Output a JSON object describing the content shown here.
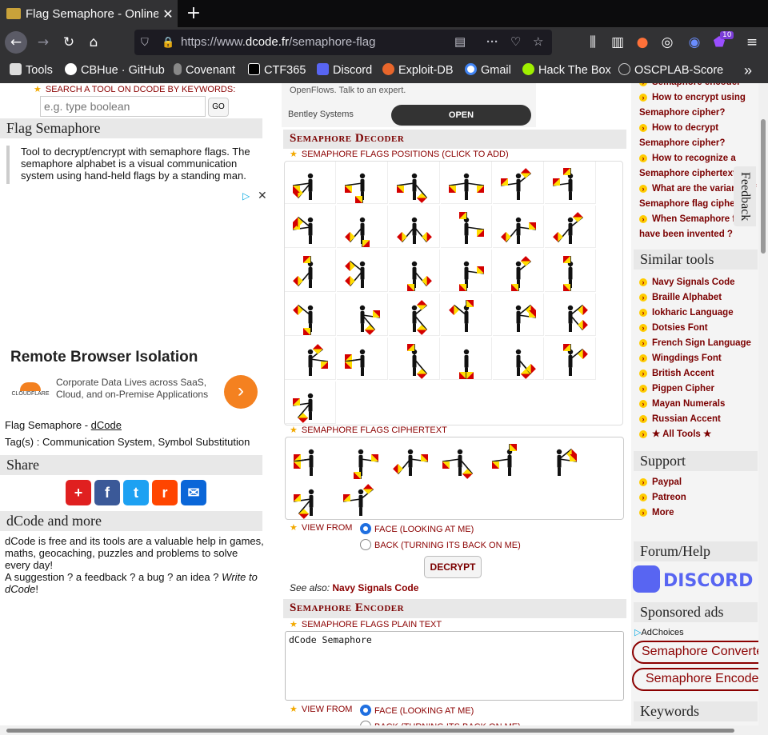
{
  "browser": {
    "tab_title": "Flag Semaphore - Online",
    "new_tab": "+",
    "url_prefix": "https://www.",
    "url_domain": "dcode.fr",
    "url_path": "/semaphore-flag",
    "extension_badge": "10",
    "bookmarks": [
      "Tools",
      "CBHue · GitHub",
      "Covenant",
      "CTF365",
      "Discord",
      "Exploit-DB",
      "Gmail",
      "Hack The Box",
      "OSCPLAB-Score"
    ]
  },
  "left": {
    "search_label": "SEARCH A TOOL ON DCODE BY KEYWORDS:",
    "search_placeholder": "e.g. type boolean",
    "go": "GO",
    "title": "Flag Semaphore",
    "description": "Tool to decrypt/encrypt with semaphore flags. The semaphore alphabet is a visual communication system using hand-held flags by a standing man.",
    "ad_title": "Remote Browser Isolation",
    "ad_text": "Corporate Data Lives across SaaS, Cloud, and on-Premise Applications",
    "ad_brand": "CLOUDFLARE",
    "credit_prefix": "Flag Semaphore - ",
    "credit_link": "dCode",
    "tags": "Tag(s) : Communication System, Symbol Substitution",
    "share_title": "Share",
    "more_title": "dCode and more",
    "more_text1": "dCode is free and its tools are a valuable help in games, maths, geocaching, puzzles and problems to solve every day!",
    "more_text2": "A suggestion ? a feedback ? a bug ? an idea ?",
    "more_link": "Write to dCode"
  },
  "mid": {
    "ad_top_text": "OpenFlows. Talk to an expert.",
    "ad_company": "Bentley Systems",
    "ad_open": "OPEN",
    "decoder_title": "Semaphore Decoder",
    "positions_label": "SEMAPHORE FLAGS POSITIONS (CLICK TO ADD)",
    "ciphertext_label": "SEMAPHORE FLAGS CIPHERTEXT",
    "view_from": "VIEW FROM",
    "face": "FACE (LOOKING AT ME)",
    "back": "BACK (TURNING ITS BACK ON ME)",
    "decrypt": "DECRYPT",
    "see_also_prefix": "See also: ",
    "see_also_link": "Navy Signals Code",
    "encoder_title": "Semaphore Encoder",
    "plaintext_label": "SEMAPHORE FLAGS PLAIN TEXT",
    "plaintext_value": "dCode Semaphore",
    "view_from2": "VIEW FROM",
    "face2": "FACE (LOOKING AT ME)",
    "back2": "BACK (TURNING ITS BACK ON ME)"
  },
  "right": {
    "faq": [
      "Semaphore encoder",
      "How to encrypt using Semaphore cipher?",
      "How to decrypt Semaphore cipher?",
      "How to recognize a Semaphore ciphertext?",
      "What are the variants of Semaphore flag cipher?",
      "When Semaphore flags have been invented ?"
    ],
    "feedback": "Feedback",
    "similar_title": "Similar tools",
    "similar": [
      "Navy Signals Code",
      "Braille Alphabet",
      "Iokharic Language",
      "Dotsies Font",
      "French Sign Language",
      "Wingdings Font",
      "British Accent",
      "Pigpen Cipher",
      "Mayan Numerals",
      "Russian Accent",
      "★ All Tools ★"
    ],
    "support_title": "Support",
    "support": [
      "Paypal",
      "Patreon",
      "More"
    ],
    "forum_title": "Forum/Help",
    "discord": "DISCORD",
    "sponsored_title": "Sponsored ads",
    "adchoices": "AdChoices",
    "sponsored_buttons": [
      "Semaphore Converter",
      "Semaphore Encoder"
    ],
    "keywords_title": "Keywords"
  },
  "colors": {
    "flag_red": "#d40000",
    "flag_yellow": "#ffdd00",
    "dcode_red": "#8b0000",
    "accent_blue": "#1f6fe0"
  },
  "semaphore": {
    "positions": [
      [
        5,
        6
      ],
      [
        4,
        6
      ],
      [
        3,
        6
      ],
      [
        2,
        6
      ],
      [
        6,
        1
      ],
      [
        6,
        0
      ],
      [
        6,
        7
      ],
      [
        5,
        4
      ],
      [
        5,
        3
      ],
      [
        2,
        0
      ],
      [
        5,
        2
      ],
      [
        5,
        1
      ],
      [
        5,
        0
      ],
      [
        5,
        7
      ],
      [
        4,
        3
      ],
      [
        4,
        2
      ],
      [
        4,
        1
      ],
      [
        4,
        0
      ],
      [
        4,
        7
      ],
      [
        3,
        2
      ],
      [
        3,
        1
      ],
      [
        0,
        7
      ],
      [
        1,
        2
      ],
      [
        1,
        3
      ],
      [
        2,
        1
      ],
      [
        6,
        6
      ],
      [
        3,
        0
      ],
      [
        4,
        4
      ],
      [
        3,
        3
      ],
      [
        1,
        0
      ],
      [
        6,
        5
      ]
    ],
    "ciphertext": [
      [
        6,
        6
      ],
      [
        4,
        2
      ],
      [
        5,
        2
      ],
      [
        3,
        6
      ],
      [
        0,
        6
      ],
      [
        1,
        2
      ],
      [
        6,
        5
      ],
      [
        6,
        1
      ]
    ]
  }
}
